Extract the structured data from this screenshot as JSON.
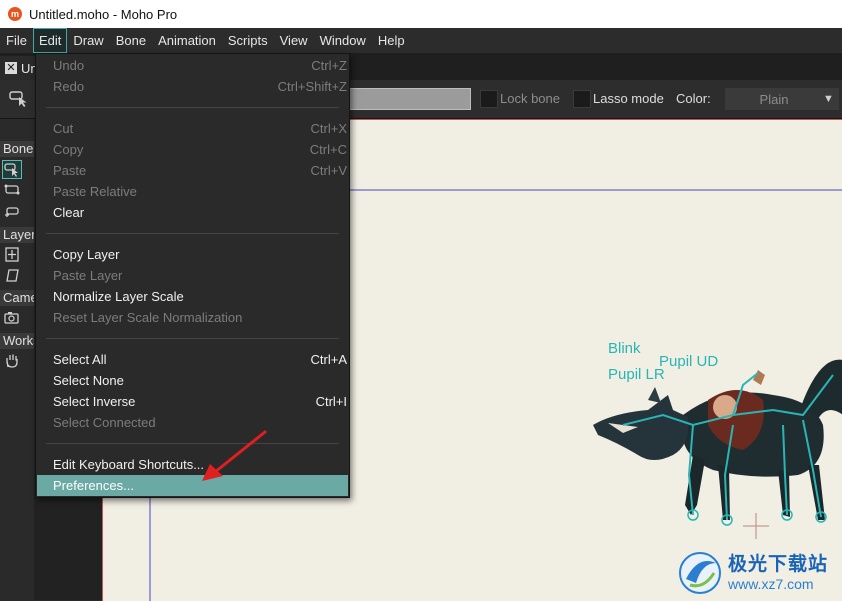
{
  "window": {
    "title": "Untitled.moho - Moho Pro",
    "app_icon": "moho-logo-icon"
  },
  "menubar": {
    "items": [
      {
        "label": "File"
      },
      {
        "label": "Edit",
        "active": true
      },
      {
        "label": "Draw"
      },
      {
        "label": "Bone"
      },
      {
        "label": "Animation"
      },
      {
        "label": "Scripts"
      },
      {
        "label": "View"
      },
      {
        "label": "Window"
      },
      {
        "label": "Help"
      }
    ]
  },
  "document_tab": {
    "label": "Untitled.moho",
    "close_icon": "close-icon"
  },
  "tool_options": {
    "lock_bone_label": "Lock bone",
    "lasso_mode_label": "Lasso mode",
    "color_label": "Color:",
    "color_value": "Plain"
  },
  "tools_panel": {
    "sections": [
      {
        "label": "Bone"
      },
      {
        "label": "Layer"
      },
      {
        "label": "Camera"
      },
      {
        "label": "Workspace"
      }
    ]
  },
  "edit_menu": {
    "items": [
      {
        "label": "Undo",
        "shortcut": "Ctrl+Z",
        "enabled": false
      },
      {
        "label": "Redo",
        "shortcut": "Ctrl+Shift+Z",
        "enabled": false
      },
      {
        "label": "Cut",
        "shortcut": "Ctrl+X",
        "enabled": false
      },
      {
        "label": "Copy",
        "shortcut": "Ctrl+C",
        "enabled": false
      },
      {
        "label": "Paste",
        "shortcut": "Ctrl+V",
        "enabled": false
      },
      {
        "label": "Paste Relative",
        "shortcut": "",
        "enabled": false
      },
      {
        "label": "Clear",
        "shortcut": "",
        "enabled": true
      },
      {
        "label": "Copy Layer",
        "shortcut": "",
        "enabled": true
      },
      {
        "label": "Paste Layer",
        "shortcut": "",
        "enabled": false
      },
      {
        "label": "Normalize Layer Scale",
        "shortcut": "",
        "enabled": true
      },
      {
        "label": "Reset Layer Scale Normalization",
        "shortcut": "",
        "enabled": false
      },
      {
        "label": "Select All",
        "shortcut": "Ctrl+A",
        "enabled": true
      },
      {
        "label": "Select None",
        "shortcut": "",
        "enabled": true
      },
      {
        "label": "Select Inverse",
        "shortcut": "Ctrl+I",
        "enabled": true
      },
      {
        "label": "Select Connected",
        "shortcut": "",
        "enabled": false
      },
      {
        "label": "Edit Keyboard Shortcuts...",
        "shortcut": "",
        "enabled": true
      },
      {
        "label": "Preferences...",
        "shortcut": "",
        "enabled": true,
        "highlighted": true
      }
    ]
  },
  "canvas": {
    "bone_labels": [
      "Blink",
      "Pupil UD",
      "Pupil LR"
    ],
    "background_color": "#f1efe3",
    "bone_color": "#2ab5b5"
  },
  "watermark": {
    "name": "极光下载站",
    "url": "www.xz7.com"
  },
  "colors": {
    "menu_highlight": "#6aa9a4",
    "annotation_arrow": "#e02020"
  }
}
